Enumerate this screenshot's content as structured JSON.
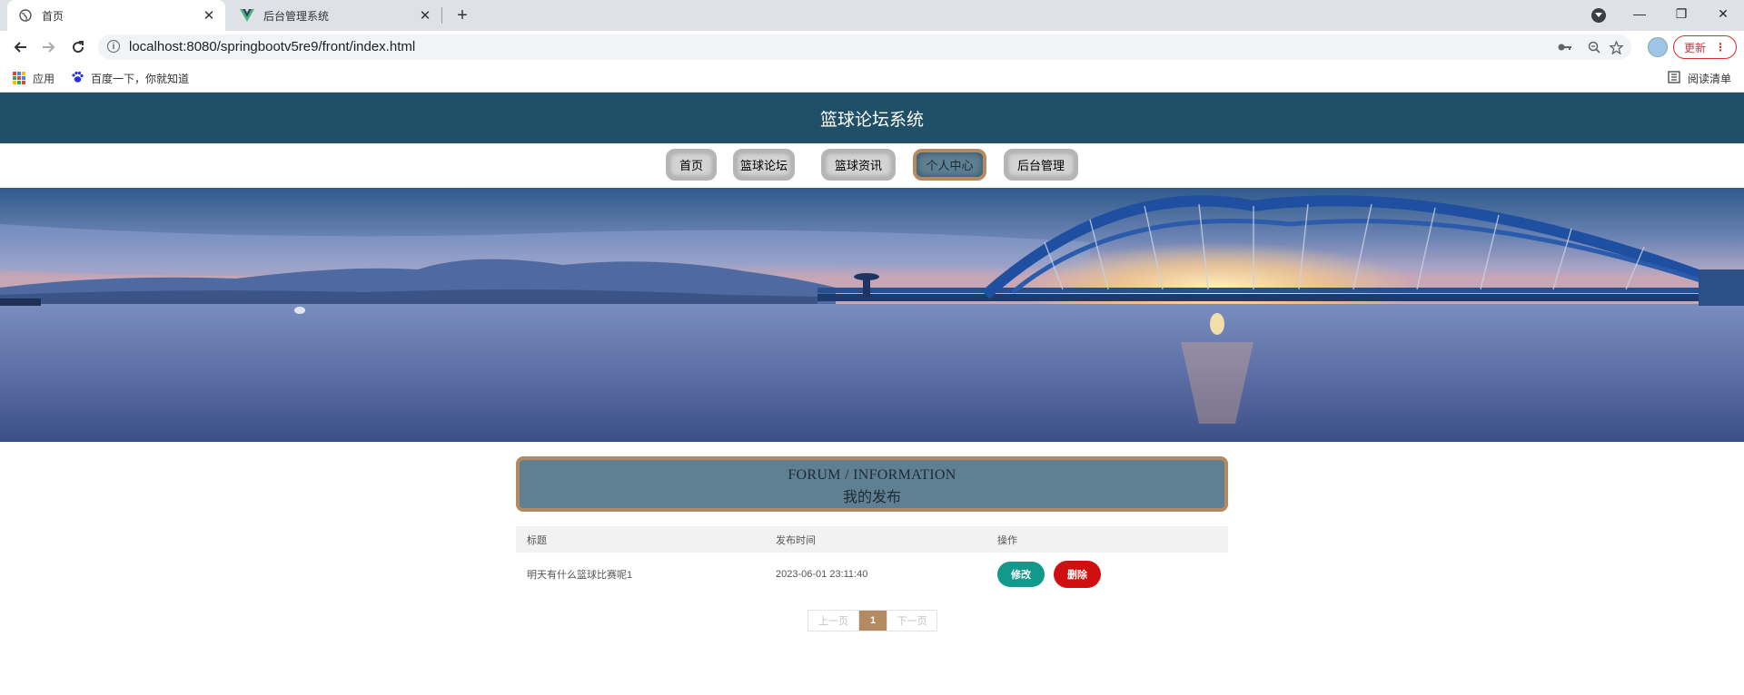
{
  "browser": {
    "tabs": [
      {
        "title": "首页",
        "active": true
      },
      {
        "title": "后台管理系统",
        "active": false
      }
    ],
    "new_tab": "+",
    "window_controls": {
      "minimize": "—",
      "restore": "❐",
      "close": "✕"
    },
    "url": "localhost:8080/springbootv5re9/front/index.html",
    "update_label": "更新",
    "bookmarks": [
      {
        "label": "应用"
      },
      {
        "label": "百度一下，你就知道"
      }
    ],
    "reading_list": "阅读清单"
  },
  "site": {
    "title": "篮球论坛系统",
    "nav": [
      {
        "label": "首页",
        "active": false
      },
      {
        "label": "篮球论坛",
        "active": false
      },
      {
        "label": "篮球资讯",
        "active": false
      },
      {
        "label": "个人中心",
        "active": true
      },
      {
        "label": "后台管理",
        "active": false
      }
    ]
  },
  "section": {
    "title_en": "FORUM / INFORMATION",
    "title_cn": "我的发布"
  },
  "table": {
    "headers": [
      "标题",
      "发布时间",
      "操作"
    ],
    "rows": [
      {
        "title": "明天有什么篮球比赛呢1",
        "time": "2023-06-01 23:11:40",
        "edit": "修改",
        "delete": "删除"
      }
    ]
  },
  "pager": {
    "prev": "上一页",
    "current": "1",
    "next": "下一页"
  },
  "colors": {
    "header_bg": "#1f5068",
    "accent_brown": "#b38a62",
    "title_box": "#5f7f92",
    "edit_btn": "#119a8c",
    "delete_btn": "#d01010"
  }
}
